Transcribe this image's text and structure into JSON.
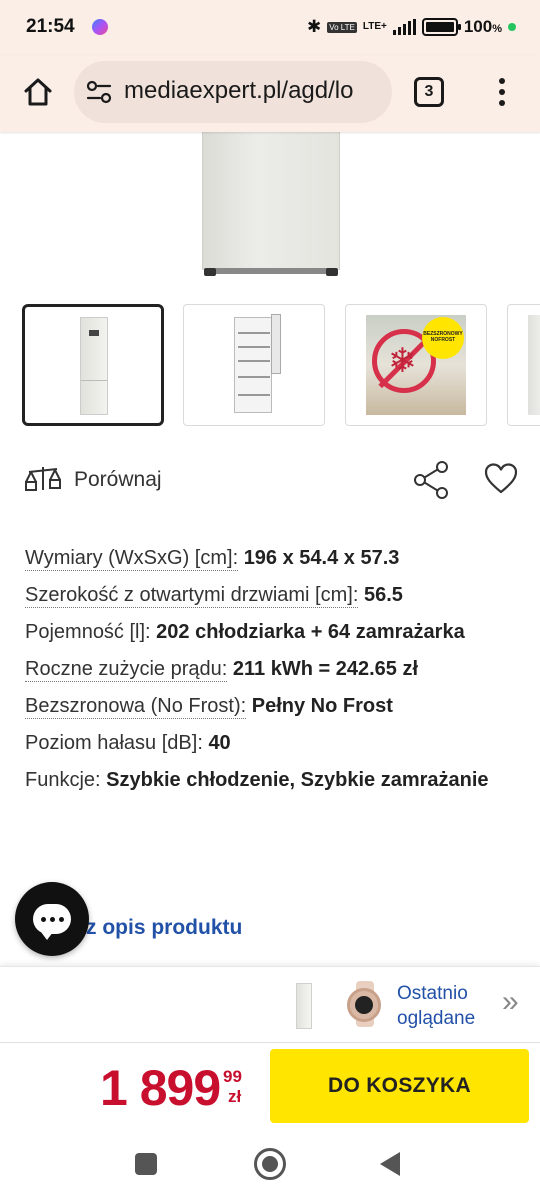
{
  "status_bar": {
    "time": "21:54",
    "network": "LTE+",
    "volte": "Vo LTE",
    "battery_percent": "100",
    "battery_unit": "%",
    "battery_level": 1.0
  },
  "browser": {
    "url": "mediaexpert.pl/agd/lo",
    "tab_count": "3"
  },
  "product": {
    "compare_label": "Porównaj",
    "specs": [
      {
        "label": "Wymiary (WxSxG) [cm]:",
        "value": "196 x 54.4 x 57.3"
      },
      {
        "label": "Szerokość z otwartymi drzwiami [cm]:",
        "value": "56.5"
      },
      {
        "label": "Pojemność [l]:",
        "value": "202 chłodziarka + 64 zamrażarka"
      },
      {
        "label": "Roczne zużycie prądu:",
        "value": "211 kWh = 242.65 zł"
      },
      {
        "label": "Bezszronowa (No Frost):",
        "value": "Pełny No Frost"
      },
      {
        "label": "Poziom hałasu [dB]:",
        "value": "40"
      },
      {
        "label": "Funkcje:",
        "value": "Szybkie chłodzenie, Szybkie zamrażanie"
      }
    ],
    "desc_link": "z opis produktu",
    "nofrost_badge": "BEZSZRONOWY NOFROST"
  },
  "recently_viewed": {
    "label_line1": "Ostatnio",
    "label_line2": "oglądane",
    "arrow": "»"
  },
  "cart": {
    "price_main": "1 899",
    "price_cents": "99",
    "price_currency": "zł",
    "button_label": "DO KOSZYKA"
  },
  "colors": {
    "price": "#c8102e",
    "cart_button": "#ffe500",
    "link": "#2251a8",
    "browser_bar": "#fbeee7"
  }
}
